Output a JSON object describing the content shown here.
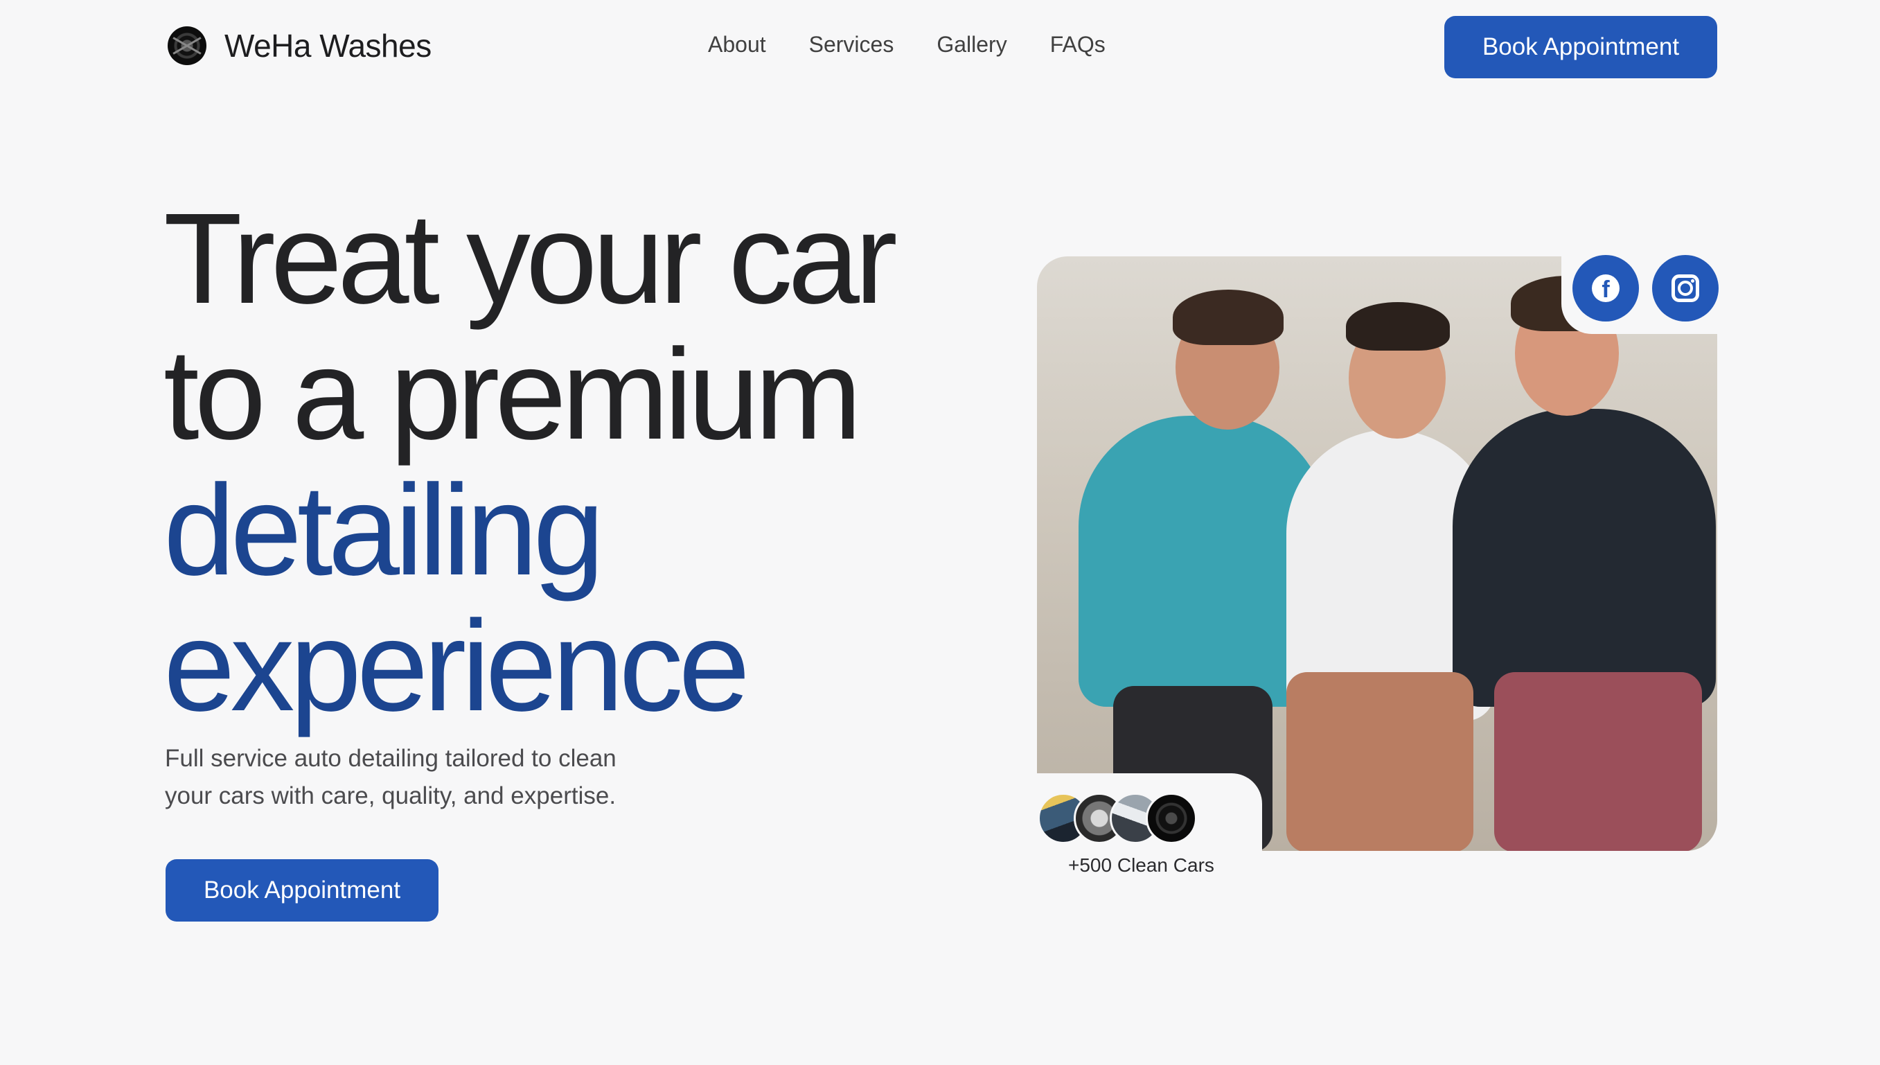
{
  "brand": {
    "name": "WeHa Washes",
    "logo_icon": "wheel-logo-icon"
  },
  "nav": {
    "links": [
      "About",
      "Services",
      "Gallery",
      "FAQs"
    ],
    "cta_label": "Book Appointment"
  },
  "hero": {
    "headline_line1": "Treat your car",
    "headline_line2": "to a premium",
    "headline_line3": "detailing",
    "headline_line4": "experience",
    "subtext": "Full service auto detailing tailored to clean your cars with care, quality, and expertise.",
    "cta_label": "Book Appointment"
  },
  "social": {
    "icons": [
      "facebook-icon",
      "instagram-icon"
    ]
  },
  "stats": {
    "clean_cars": "+500 Clean Cars"
  },
  "colors": {
    "accent": "#2358b8",
    "headline_blue": "#1c4590",
    "background": "#f7f7f8"
  }
}
